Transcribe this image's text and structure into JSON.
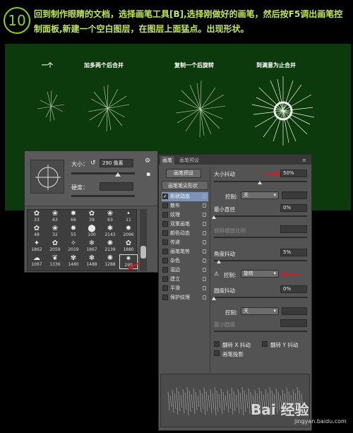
{
  "step": {
    "number": "10"
  },
  "header": {
    "text": "回到制作眼睛的文档，选择画笔工具[B],选择刚做好的画笔，然后按F5调出画笔控制面板,新建一个空白图层，在图层上面猛点。出现形状。"
  },
  "preview": {
    "labels": [
      "一个",
      "加多两个后合并",
      "复制一个后旋转",
      "到满意为止合并"
    ]
  },
  "picker": {
    "size_label": "大小：",
    "size_value": "290 像素",
    "hardness_label": "硬度：",
    "brushes": [
      {
        "glyph": "✿",
        "num": "33"
      },
      {
        "glyph": "❀",
        "num": "63"
      },
      {
        "glyph": "✸",
        "num": "66"
      },
      {
        "glyph": "✿",
        "num": "39"
      },
      {
        "glyph": "❀",
        "num": "63"
      },
      {
        "glyph": "•",
        "num": "11"
      },
      {
        "glyph": "✿",
        "num": "48"
      },
      {
        "glyph": "❀",
        "num": "32"
      },
      {
        "glyph": "✹",
        "num": "55"
      },
      {
        "glyph": "⬤",
        "num": "100"
      },
      {
        "glyph": "✱",
        "num": "2143"
      },
      {
        "glyph": "✸",
        "num": "2096"
      },
      {
        "glyph": "✦",
        "num": "1862"
      },
      {
        "glyph": "✿",
        "num": "2059"
      },
      {
        "glyph": "✧",
        "num": "2019"
      },
      {
        "glyph": "❄",
        "num": "1867"
      },
      {
        "glyph": "✺",
        "num": "2139"
      },
      {
        "glyph": "✿",
        "num": "1880"
      },
      {
        "glyph": "☁",
        "num": "1067"
      },
      {
        "glyph": "❦",
        "num": "1336"
      },
      {
        "glyph": "✾",
        "num": "1480"
      },
      {
        "glyph": "❃",
        "num": "1488"
      },
      {
        "glyph": "✺",
        "num": "1288"
      },
      {
        "glyph": "✷",
        "num": "290"
      }
    ]
  },
  "panel": {
    "tab_brush": "画笔",
    "tab_presets": "画笔预设",
    "preset_button": "画笔预设",
    "list": [
      {
        "label": "画笔笔尖形状",
        "head": true
      },
      {
        "label": "形状动态",
        "checked": true,
        "selected": true
      },
      {
        "label": "散布"
      },
      {
        "label": "纹理"
      },
      {
        "label": "双重画笔"
      },
      {
        "label": "颜色动态"
      },
      {
        "label": "传递"
      },
      {
        "label": "画笔笔势"
      },
      {
        "label": "杂色"
      },
      {
        "label": "湿边"
      },
      {
        "label": "建立"
      },
      {
        "label": "平滑"
      },
      {
        "label": "保护纹理"
      }
    ],
    "size_jitter_label": "大小抖动",
    "size_jitter_value": "50%",
    "control_label": "控制:",
    "control_off": "关",
    "min_diameter_label": "最小直径",
    "min_diameter_value": "0%",
    "tilt_scale_label": "倾斜缩放比例",
    "angle_jitter_label": "角度抖动",
    "angle_jitter_value": "5%",
    "control_rotation": "旋转",
    "roundness_jitter_label": "圆度抖动",
    "roundness_jitter_value": "0%",
    "min_roundness_label": "最小圆度",
    "flip_x_label": "翻转 X 抖动",
    "flip_y_label": "翻转 Y 抖动",
    "projection_label": "画笔投影"
  },
  "watermark": {
    "brand": "Bai 经验",
    "url": "jingyan.baidu.com"
  },
  "colors": {
    "header": "#bfe84a",
    "preview_bg": "#0d3a0d",
    "panel_bg": "#535353",
    "selection": "#7c94b6",
    "arrow": "#e01818"
  }
}
